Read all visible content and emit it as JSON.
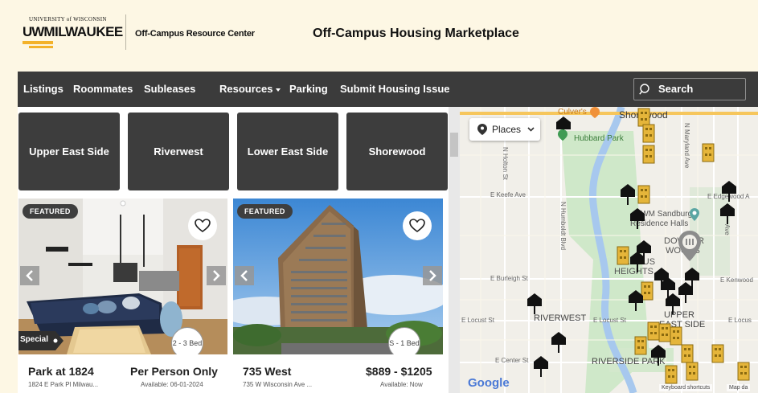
{
  "header": {
    "logo_top": "UNIVERSITY of WISCONSIN",
    "logo_uw": "UW",
    "logo_main": "MILWAUKEE",
    "center_name": "Off-Campus Resource Center",
    "title": "Off-Campus Housing Marketplace"
  },
  "nav": {
    "items": [
      "Listings",
      "Roommates",
      "Subleases",
      "Resources",
      "Parking",
      "Submit Housing Issue"
    ],
    "search_label": "Search"
  },
  "neighborhoods": [
    "Upper East Side",
    "Riverwest",
    "Lower East Side",
    "Shorewood"
  ],
  "listings": [
    {
      "badge": "FEATURED",
      "name": "Park at 1824",
      "address": "1824 E Park Pl Milwau...",
      "price": "Per Person Only",
      "available": "Available: 06-01-2024",
      "beds": "2 - 3 Bed",
      "special": "Special"
    },
    {
      "badge": "FEATURED",
      "name": "735 West",
      "address": "735 W Wisconsin Ave ...",
      "price": "$889 - $1205",
      "available": "Available: Now",
      "beds": "S - 1 Bed"
    }
  ],
  "map": {
    "places_label": "Places",
    "labels": {
      "shorewood": "Shorewood",
      "hubbard": "Hubbard Park",
      "culvers": "Culver's",
      "keefe": "E Keefe Ave",
      "holton": "N Holton St",
      "humboldt": "N Humboldt Blvd",
      "maryland": "N Maryland Ave",
      "edgewood": "E Edgewood A",
      "uwm": "UWM Sandburg",
      "halls": "Residence Halls",
      "downer1": "DOWNER",
      "downer2": "WOODS",
      "campus1": "CAMPUS",
      "campus2": "HEIGHTS",
      "burleigh": "E Burleigh St",
      "kenwood": "E Kenwood",
      "locust_w": "E Locust St",
      "riverwest": "RIVERWEST",
      "locust_m": "E Locust St",
      "locust_e": "E Locus",
      "upper1": "UPPER",
      "upper2": "EAST SIDE",
      "center": "E Center St",
      "riverside": "RIVERSIDE PARK",
      "ave": "Ave"
    },
    "google": "Google",
    "shortcuts": "Keyboard shortcuts",
    "mapdata": "Map da"
  },
  "colors": {
    "nav_bg": "#3b3b3b",
    "page_bg": "#fdf7e4",
    "gold": "#f3b22a",
    "map_marker_gold": "#e5b53a"
  }
}
